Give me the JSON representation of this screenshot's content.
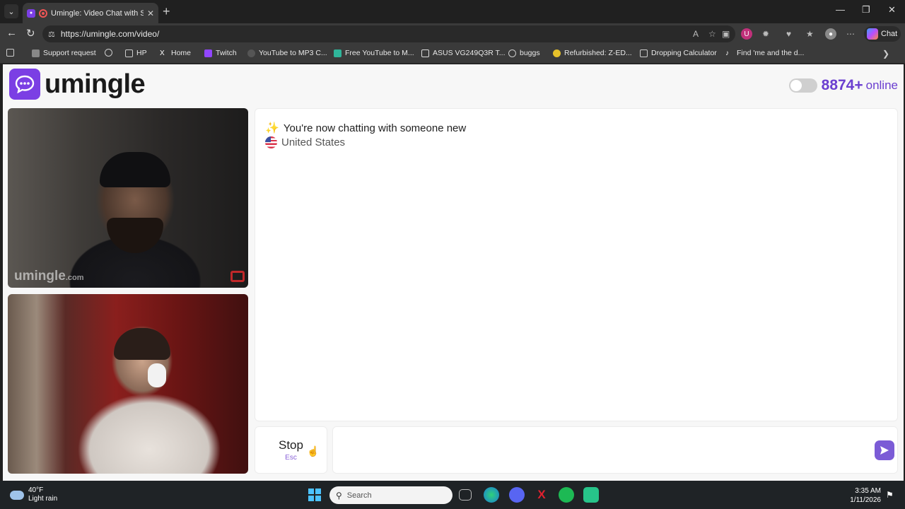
{
  "browser": {
    "tab_title": "Umingle: Video Chat with Stra",
    "url": "https://umingle.com/video/",
    "copilot_label": "Chat",
    "bookmarks": [
      "Support request",
      "HP",
      "Home",
      "Twitch",
      "YouTube to MP3 C...",
      "Free YouTube to M...",
      "ASUS VG249Q3R T...",
      "buggs",
      "Refurbished: Z-ED...",
      "Dropping Calculator",
      "Find 'me and the d..."
    ]
  },
  "header": {
    "logo_text": "umingle",
    "online_count": "8874+",
    "online_label": "online"
  },
  "videos": {
    "watermark": "umingle",
    "watermark_suffix": ".com"
  },
  "chat": {
    "status_message": "You're now chatting with someone new",
    "country": "United States"
  },
  "controls": {
    "stop_label": "Stop",
    "stop_shortcut": "Esc",
    "message_placeholder": ""
  },
  "taskbar": {
    "temperature": "40°F",
    "weather": "Light rain",
    "search_placeholder": "Search",
    "time": "3:35 AM",
    "date": "1/11/2026"
  },
  "colors": {
    "brand": "#7b3fe4",
    "online": "#6b3fd0",
    "send_button": "#7b5bd6"
  }
}
